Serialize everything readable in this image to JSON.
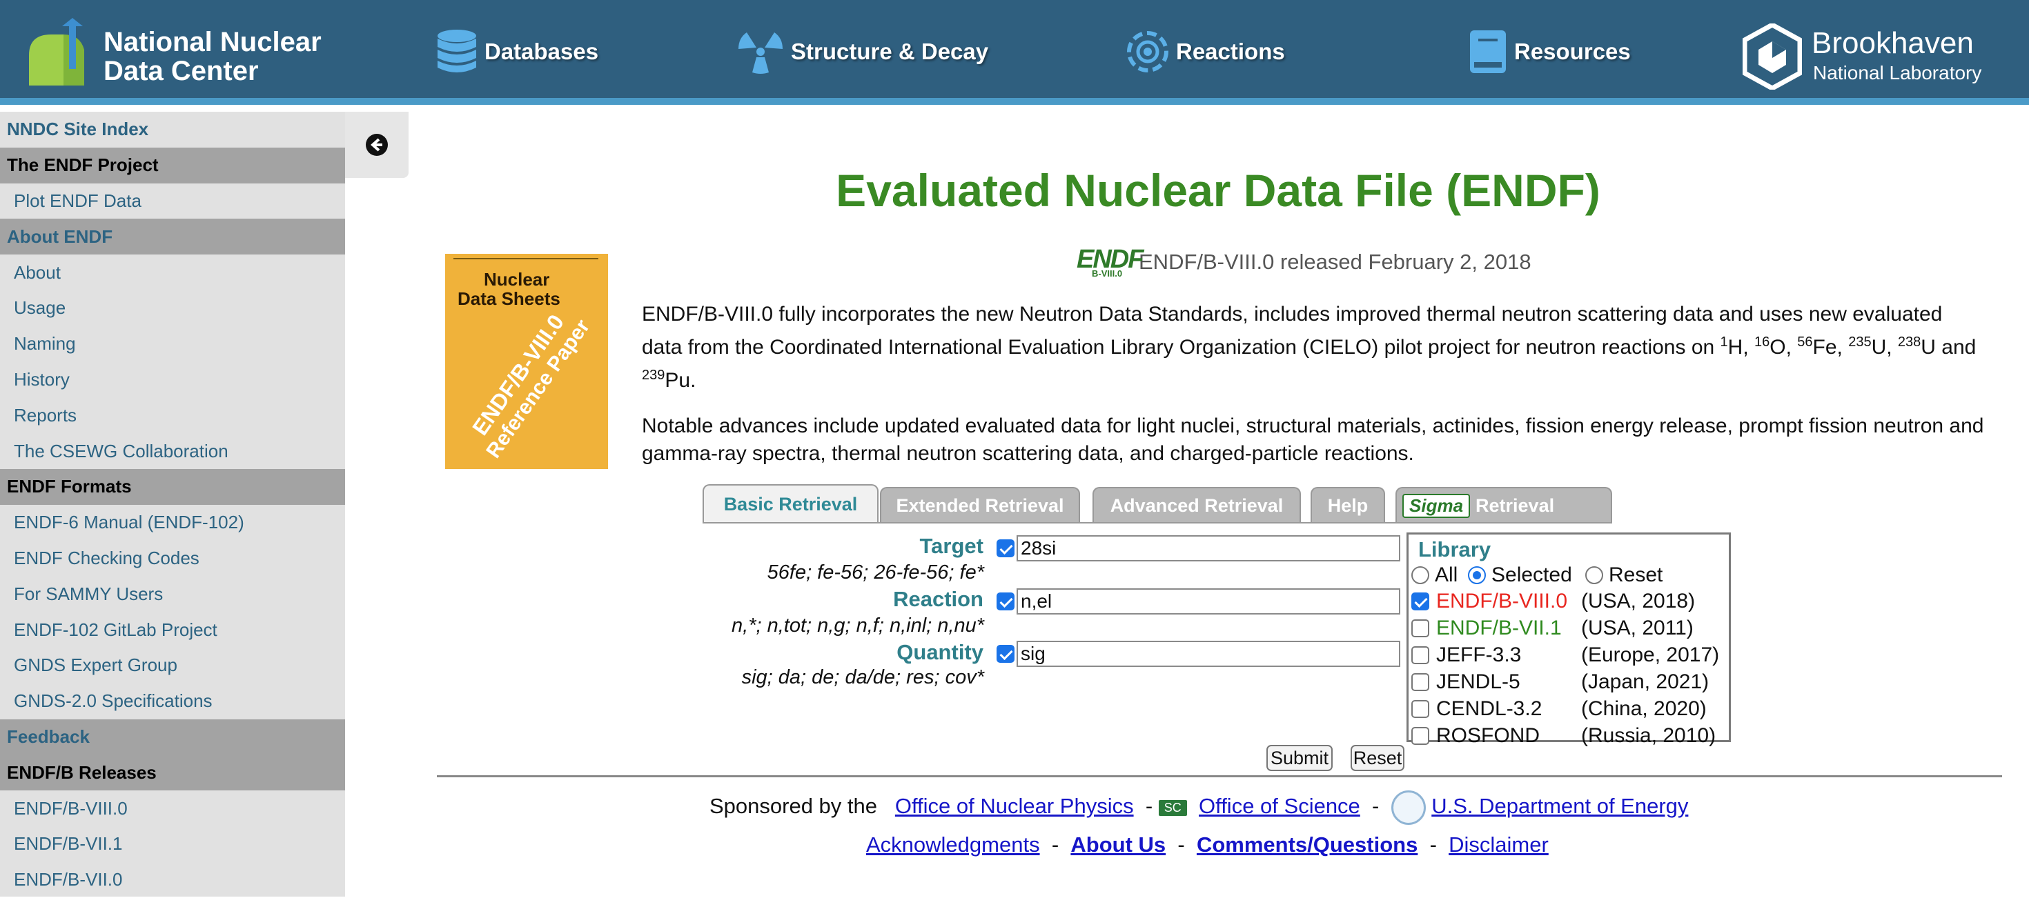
{
  "header": {
    "brand_line1": "National Nuclear",
    "brand_line2": "Data Center",
    "nav": [
      {
        "label": "Databases",
        "icon": "database-icon"
      },
      {
        "label": "Structure & Decay",
        "icon": "radiation-icon"
      },
      {
        "label": "Reactions",
        "icon": "atom-icon"
      },
      {
        "label": "Resources",
        "icon": "book-icon"
      }
    ],
    "bnl_line1": "Brookhaven",
    "bnl_line2": "National Laboratory"
  },
  "sidebar": {
    "items": [
      {
        "label": "NNDC Site Index",
        "kind": "top"
      },
      {
        "label": "The ENDF Project",
        "kind": "sec-dark"
      },
      {
        "label": "Plot ENDF Data",
        "kind": "item"
      },
      {
        "label": "About ENDF",
        "kind": "sec-blue"
      },
      {
        "label": "About",
        "kind": "item"
      },
      {
        "label": "Usage",
        "kind": "item"
      },
      {
        "label": "Naming",
        "kind": "item"
      },
      {
        "label": "History",
        "kind": "item"
      },
      {
        "label": "Reports",
        "kind": "item"
      },
      {
        "label": "The CSEWG Collaboration",
        "kind": "item"
      },
      {
        "label": "ENDF Formats",
        "kind": "sec-dark"
      },
      {
        "label": "ENDF-6 Manual (ENDF-102)",
        "kind": "item"
      },
      {
        "label": "ENDF Checking Codes",
        "kind": "item"
      },
      {
        "label": "For SAMMY Users",
        "kind": "item"
      },
      {
        "label": "ENDF-102 GitLab Project",
        "kind": "item"
      },
      {
        "label": "GNDS Expert Group",
        "kind": "item"
      },
      {
        "label": "GNDS-2.0 Specifications",
        "kind": "item"
      },
      {
        "label": "Feedback",
        "kind": "sec-blue"
      },
      {
        "label": "ENDF/B Releases",
        "kind": "sec-dark"
      },
      {
        "label": "ENDF/B-VIII.0",
        "kind": "item"
      },
      {
        "label": "ENDF/B-VII.1",
        "kind": "item"
      },
      {
        "label": "ENDF/B-VII.0",
        "kind": "item"
      }
    ]
  },
  "main": {
    "title": "Evaluated Nuclear Data File (ENDF)",
    "cover": {
      "line1": "Nuclear",
      "line2": "Data Sheets",
      "diag1": "ENDF/B-VIII.0",
      "diag2": "Reference Paper"
    },
    "logo_text": "ENDF",
    "logo_sub": "B-VIII.0",
    "release_text": "ENDF/B-VIII.0 released February 2, 2018",
    "para1": {
      "t1": "ENDF/B-VIII.0 fully incorporates the new Neutron Data Standards, includes improved thermal neutron scattering data and uses new evaluated data from the Coordinated International Evaluation Library Organization (CIELO) pilot project for neutron reactions on ",
      "s1": "1",
      "e1": "H, ",
      "s2": "16",
      "e2": "O,",
      "s3": "56",
      "e3": "Fe, ",
      "s4": "235",
      "e4": "U, ",
      "s5": "238",
      "e5": "U and ",
      "s6": "239",
      "e6": "Pu."
    },
    "para2": "Notable advances include updated evaluated data for light nuclei, structural materials, actinides, fission energy release, prompt fission neutron and gamma-ray spectra, thermal neutron scattering data, and charged-particle reactions."
  },
  "tabs": {
    "basic": "Basic Retrieval",
    "extended": "Extended Retrieval",
    "advanced": "Advanced Retrieval",
    "help": "Help",
    "sigma_logo": "Sigma",
    "sigma": "Retrieval"
  },
  "form": {
    "target_label": "Target",
    "target_hint": "56fe; fe-56; 26-fe-56; fe*",
    "target_value": "28si",
    "reaction_label": "Reaction",
    "reaction_hint": "n,*; n,tot; n,g; n,f; n,inl; n,nu*",
    "reaction_value": "n,el",
    "quantity_label": "Quantity",
    "quantity_hint": "sig; da; de; da/de; res; cov*",
    "quantity_value": "sig",
    "submit": "Submit",
    "reset": "Reset"
  },
  "library": {
    "heading": "Library",
    "radio_all": "All",
    "radio_selected": "Selected",
    "radio_reset": "Reset",
    "entries": [
      {
        "name": "ENDF/B-VIII.0",
        "info": "(USA, 2018)",
        "checked": true,
        "color": "#e8261f"
      },
      {
        "name": "ENDF/B-VII.1",
        "info": "(USA, 2011)",
        "checked": false,
        "color": "#2f8a1f"
      },
      {
        "name": "JEFF-3.3",
        "info": "(Europe, 2017)",
        "checked": false,
        "color": "#111111"
      },
      {
        "name": "JENDL-5",
        "info": "(Japan, 2021)",
        "checked": false,
        "color": "#111111"
      },
      {
        "name": "CENDL-3.2",
        "info": "(China, 2020)",
        "checked": false,
        "color": "#111111"
      },
      {
        "name": "ROSFOND",
        "info": "(Russia, 2010)",
        "checked": false,
        "color": "#111111"
      }
    ]
  },
  "footer": {
    "sponsored": "Sponsored by the",
    "onp": "Office of Nuclear Physics",
    "sc_badge": "SC",
    "dash": "-",
    "sc": "Office of Science",
    "doe": "U.S. Department of Energy",
    "ack": "Acknowledgments",
    "about": "About Us",
    "comments": "Comments/Questions",
    "disclaimer": "Disclaimer"
  }
}
